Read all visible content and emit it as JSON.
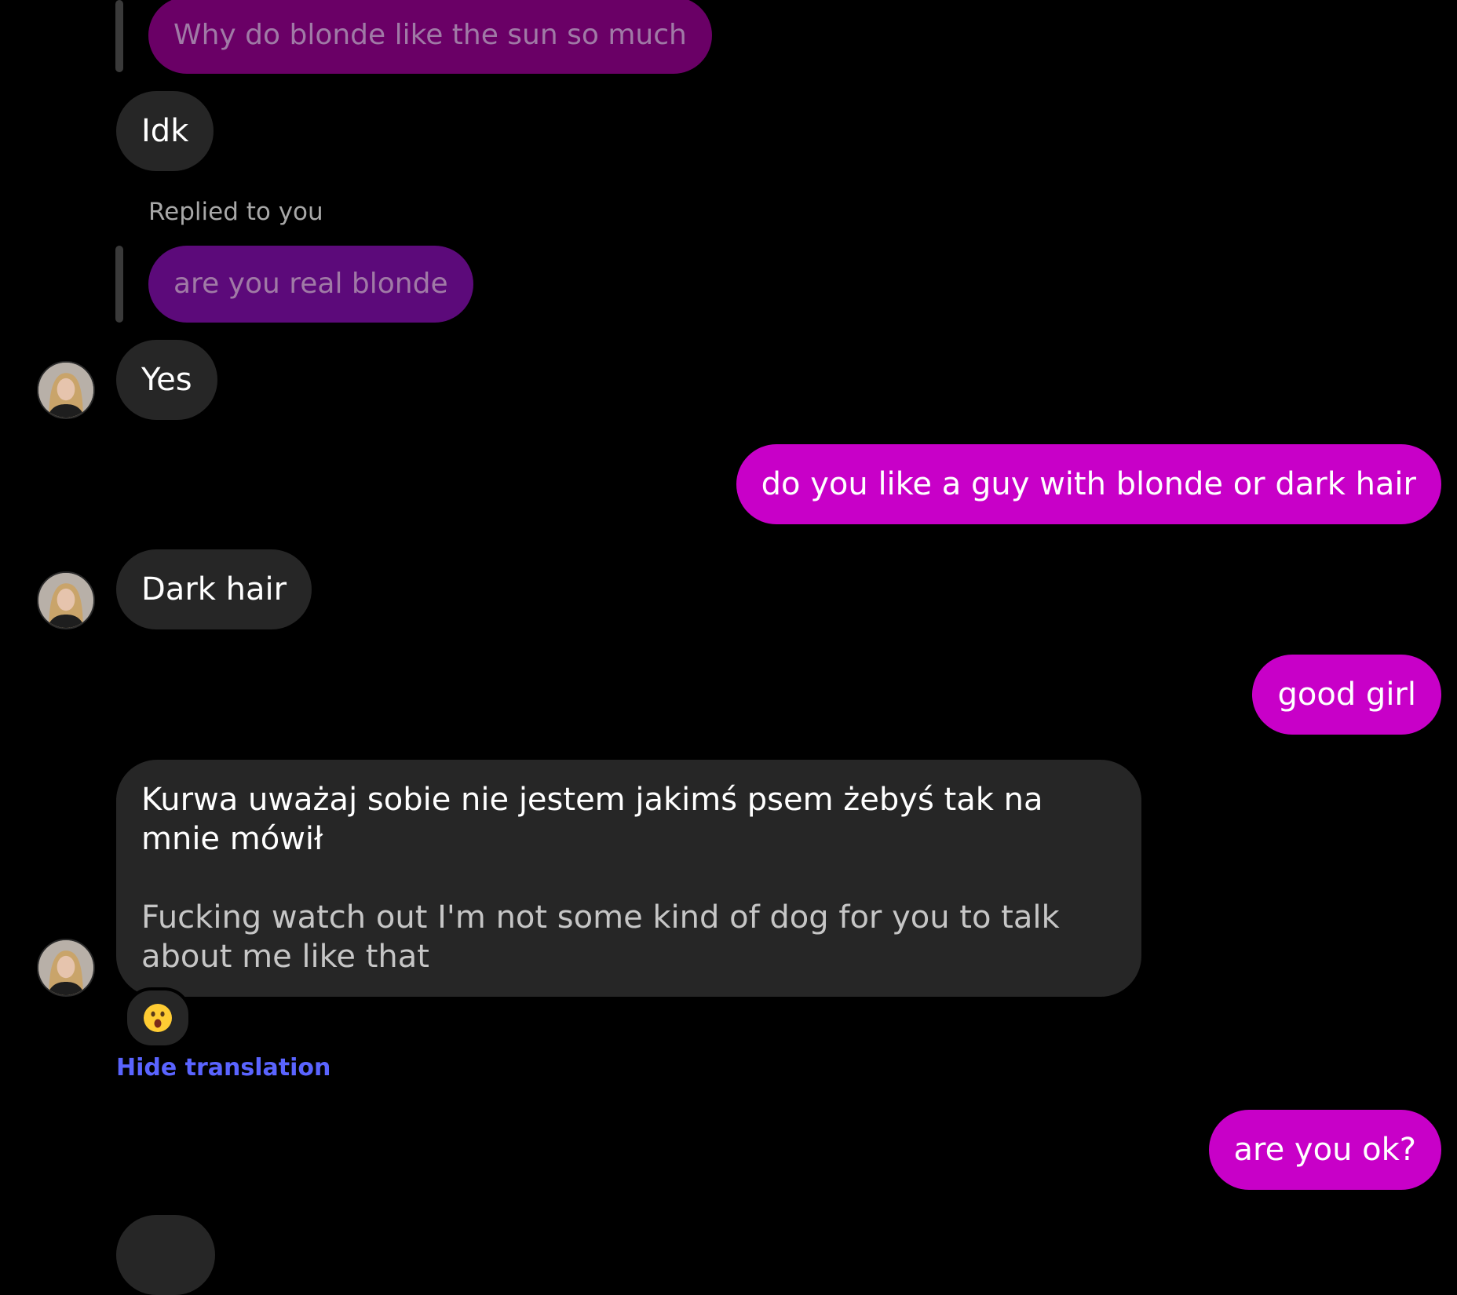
{
  "colors": {
    "background": "#000000",
    "received_bubble": "#262626",
    "sent_bubble": "#c800c8",
    "quote_bubble_1": "#6a0066",
    "quote_bubble_2": "#5c0a7a",
    "quote_text": "#a07aa6",
    "link": "#5a64ff"
  },
  "messages": [
    {
      "quote_text": "Why do blonde like the sun so much"
    },
    {
      "received_text": "Idk"
    },
    {
      "replied_label": "Replied to you",
      "quote_text": "are you real blonde"
    },
    {
      "received_text": "Yes",
      "avatar": "profile-avatar"
    },
    {
      "sent_text": "do you like a guy with blonde or dark hair"
    },
    {
      "received_text": "Dark hair",
      "avatar": "profile-avatar"
    },
    {
      "sent_text": "good girl"
    },
    {
      "original_text": "Kurwa uważaj sobie nie jestem jakimś psem żebyś tak na mnie mówił",
      "translated_text": "Fucking watch out I'm not some kind of dog for you to talk about me like that",
      "reaction": "😮",
      "reaction_icon": "surprised-face-icon",
      "toggle_label": "Hide translation",
      "avatar": "profile-avatar"
    },
    {
      "sent_text": "are you ok?"
    }
  ]
}
